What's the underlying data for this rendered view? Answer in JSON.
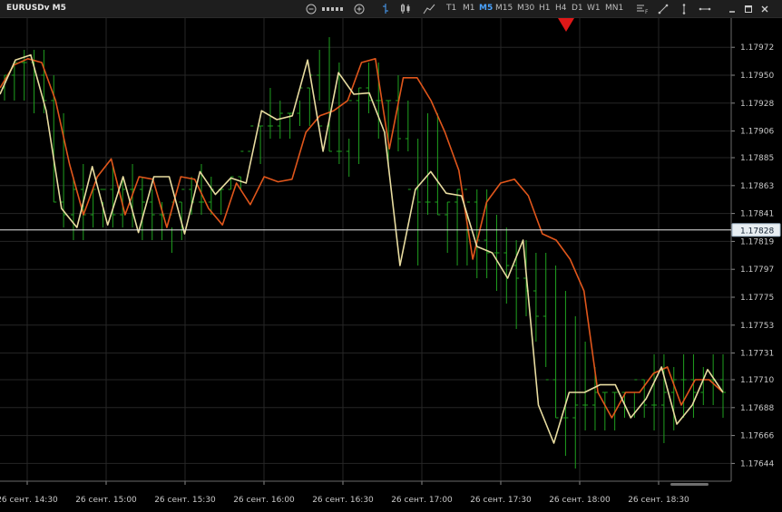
{
  "toolbar": {
    "symbol": "EURUSDv M5",
    "zoom_out_icon": "zoom-out-icon",
    "zoom_in_icon": "zoom-in-icon",
    "timeframes": [
      "T1",
      "M1",
      "M5",
      "M15",
      "M30",
      "H1",
      "H4",
      "D1",
      "W1",
      "MN1"
    ],
    "active_timeframe": "M5",
    "window_buttons": [
      "minimize-icon",
      "maximize-icon",
      "close-icon"
    ]
  },
  "chart_data": {
    "type": "line",
    "symbol": "EURUSDv",
    "timeframe": "M5",
    "ylim": [
      1.1763,
      1.17995
    ],
    "current_price": 1.17828,
    "current_price_label": "1.17828",
    "y_ticks": [
      "1.17972",
      "1.17950",
      "1.17928",
      "1.17906",
      "1.17885",
      "1.17863",
      "1.17841",
      "1.17819",
      "1.17797",
      "1.17775",
      "1.17753",
      "1.17731",
      "1.17710",
      "1.17688",
      "1.17666",
      "1.17644"
    ],
    "x_ticks": [
      "26 сент. 14:30",
      "26 сент. 15:00",
      "26 сент. 15:30",
      "26 сент. 16:00",
      "26 сент. 16:30",
      "26 сент. 17:00",
      "26 сент. 17:30",
      "26 сент. 18:00",
      "26 сент. 18:30"
    ],
    "bars": {
      "name": "price-bars",
      "color": "#1fa01f",
      "high": [
        1.1795,
        1.1796,
        1.1797,
        1.1797,
        1.1797,
        1.1795,
        1.1792,
        1.1787,
        1.1788,
        1.1786,
        1.1785,
        1.1788,
        1.1787,
        1.1788,
        1.1787,
        1.1786,
        1.1785,
        1.1783,
        1.1785,
        1.1787,
        1.1788,
        1.1787,
        1.1786,
        1.1787,
        1.1787,
        1.1786,
        1.1791,
        1.1794,
        1.1793,
        1.1792,
        1.1793,
        1.1794,
        1.1797,
        1.1798,
        1.1796,
        1.179,
        1.1794,
        1.1796,
        1.1796,
        1.1793,
        1.1795,
        1.1793,
        1.179,
        1.1792,
        1.1792,
        1.1785,
        1.1786,
        1.1784,
        1.1786,
        1.1786,
        1.1784,
        1.1783,
        1.1782,
        1.1782,
        1.1781,
        1.1781,
        1.178,
        1.1778,
        1.1776,
        1.1774,
        1.1772,
        1.177,
        1.177,
        1.177,
        1.177,
        1.1771,
        1.1773,
        1.1773,
        1.1772,
        1.1773,
        1.1773,
        1.1772,
        1.1773,
        1.1773
      ],
      "low": [
        1.1793,
        1.1793,
        1.1793,
        1.1792,
        1.1792,
        1.1785,
        1.1783,
        1.1782,
        1.1782,
        1.1783,
        1.1783,
        1.1783,
        1.1783,
        1.1783,
        1.1782,
        1.1782,
        1.1782,
        1.1781,
        1.1782,
        1.1784,
        1.1784,
        1.1784,
        1.1784,
        1.1786,
        1.1786,
        1.1786,
        1.1788,
        1.179,
        1.179,
        1.179,
        1.1791,
        1.1791,
        1.1793,
        1.1789,
        1.1788,
        1.1787,
        1.1788,
        1.1792,
        1.179,
        1.1788,
        1.1789,
        1.1789,
        1.178,
        1.1784,
        1.1784,
        1.1781,
        1.178,
        1.178,
        1.1779,
        1.1779,
        1.1778,
        1.1777,
        1.1775,
        1.1776,
        1.1774,
        1.1772,
        1.1768,
        1.1765,
        1.1764,
        1.1767,
        1.1767,
        1.1767,
        1.1767,
        1.1768,
        1.1768,
        1.1768,
        1.1767,
        1.1766,
        1.1767,
        1.1768,
        1.1768,
        1.1769,
        1.1769,
        1.1768
      ],
      "open": [
        1.1794,
        1.1795,
        1.1796,
        1.1796,
        1.1795,
        1.1793,
        1.1785,
        1.1784,
        1.1786,
        1.1784,
        1.1786,
        1.1786,
        1.1784,
        1.1786,
        1.1786,
        1.1785,
        1.1784,
        1.1784,
        1.1785,
        1.1786,
        1.1785,
        1.1785,
        1.1786,
        1.1786,
        1.1787,
        1.1789,
        1.1791,
        1.1791,
        1.1791,
        1.1792,
        1.1792,
        1.1794,
        1.1795,
        1.1791,
        1.1789,
        1.1789,
        1.1793,
        1.1794,
        1.1793,
        1.1793,
        1.1793,
        1.179,
        1.1786,
        1.1785,
        1.1785,
        1.1784,
        1.1785,
        1.1786,
        1.1785,
        1.1782,
        1.1781,
        1.1781,
        1.178,
        1.1779,
        1.1778,
        1.1776,
        1.1771,
        1.1768,
        1.1768,
        1.1769,
        1.1769,
        1.177,
        1.177,
        1.177,
        1.177,
        1.1771,
        1.1769,
        1.1769,
        1.177,
        1.1771,
        1.1771,
        1.177,
        1.1771,
        1.1771
      ],
      "close": [
        1.1795,
        1.1796,
        1.1796,
        1.1795,
        1.1793,
        1.1785,
        1.1784,
        1.1786,
        1.1784,
        1.1786,
        1.1786,
        1.1784,
        1.1786,
        1.1786,
        1.1785,
        1.1784,
        1.1784,
        1.1785,
        1.1786,
        1.1785,
        1.1785,
        1.1786,
        1.1786,
        1.1787,
        1.1789,
        1.1791,
        1.1791,
        1.1791,
        1.1792,
        1.1792,
        1.1794,
        1.1795,
        1.1791,
        1.1789,
        1.1789,
        1.1793,
        1.1794,
        1.1793,
        1.1793,
        1.1793,
        1.179,
        1.1786,
        1.1785,
        1.1785,
        1.1784,
        1.1785,
        1.1786,
        1.1785,
        1.1782,
        1.1781,
        1.1781,
        1.178,
        1.1779,
        1.1778,
        1.1776,
        1.1771,
        1.1768,
        1.1768,
        1.1769,
        1.1769,
        1.177,
        1.177,
        1.177,
        1.177,
        1.1771,
        1.1769,
        1.1769,
        1.177,
        1.1771,
        1.1771,
        1.177,
        1.1771,
        1.1771,
        1.177
      ]
    },
    "series": [
      {
        "color": "#e0561b",
        "values": [
          1.1794,
          1.17958,
          1.17963,
          1.1796,
          1.1793,
          1.1788,
          1.1784,
          1.1787,
          1.17884,
          1.1784,
          1.1787,
          1.17868,
          1.1783,
          1.1787,
          1.17868,
          1.17845,
          1.17832,
          1.17865,
          1.17848,
          1.1787,
          1.17866,
          1.17868,
          1.17905,
          1.17918,
          1.17922,
          1.1793,
          1.1796,
          1.17963,
          1.17892,
          1.17948,
          1.17948,
          1.1793,
          1.17905,
          1.17875,
          1.17805,
          1.1785,
          1.17865,
          1.17868,
          1.17855,
          1.17825,
          1.1782,
          1.17805,
          1.1778,
          1.177,
          1.1768,
          1.177,
          1.177,
          1.17715,
          1.1772,
          1.1769,
          1.1771,
          1.1771,
          1.177
        ]
      },
      {
        "color": "#e8dca0",
        "values": [
          1.17935,
          1.17962,
          1.17966,
          1.17922,
          1.17845,
          1.1783,
          1.17878,
          1.17832,
          1.1787,
          1.17826,
          1.1787,
          1.1787,
          1.17825,
          1.17874,
          1.17856,
          1.17869,
          1.17865,
          1.17922,
          1.17915,
          1.17918,
          1.17962,
          1.1789,
          1.17952,
          1.17935,
          1.17936,
          1.17905,
          1.178,
          1.1786,
          1.17874,
          1.17857,
          1.17855,
          1.17815,
          1.1781,
          1.1779,
          1.1782,
          1.1769,
          1.1766,
          1.177,
          1.177,
          1.17706,
          1.17706,
          1.1768,
          1.17695,
          1.1772,
          1.17675,
          1.1769,
          1.17718,
          1.177
        ]
      }
    ]
  }
}
